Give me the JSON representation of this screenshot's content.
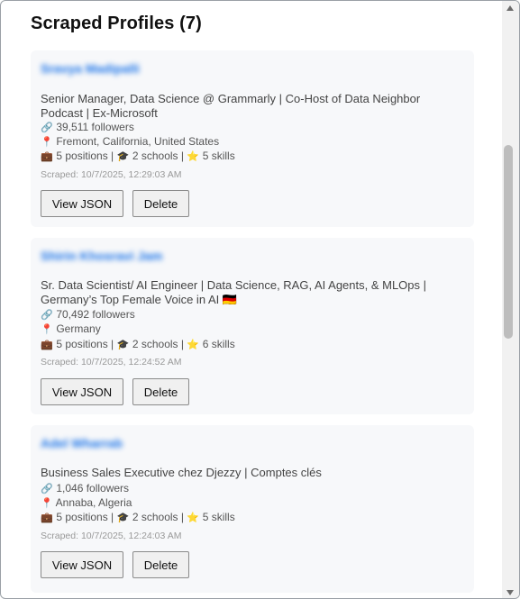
{
  "header": {
    "title": "Scraped Profiles (7)"
  },
  "icons": {
    "link": "link-icon",
    "location": "pin-icon",
    "positions": "briefcase-icon",
    "schools": "graduation-cap-icon",
    "skills": "star-icon"
  },
  "profiles": [
    {
      "name": "Sravya Madipalli",
      "headline": "Senior Manager, Data Science @ Grammarly | Co-Host of Data Neighbor Podcast | Ex-Microsoft",
      "followers": "39,511 followers",
      "location": "Fremont, California, United States",
      "stats": {
        "positions": "5 positions",
        "schools": "2 schools",
        "skills": "5 skills"
      },
      "scraped": "Scraped: 10/7/2025, 12:29:03 AM",
      "view_label": "View JSON",
      "delete_label": "Delete"
    },
    {
      "name": "Shirin Khosravi Jam",
      "headline": "Sr. Data Scientist/ AI Engineer | Data Science, RAG, AI Agents, & MLOps | Germany’s Top Female Voice in AI 🇩🇪",
      "followers": "70,492 followers",
      "location": "Germany",
      "stats": {
        "positions": "5 positions",
        "schools": "2 schools",
        "skills": "6 skills"
      },
      "scraped": "Scraped: 10/7/2025, 12:24:52 AM",
      "view_label": "View JSON",
      "delete_label": "Delete"
    },
    {
      "name": "Adel Wharrab",
      "headline": "Business Sales Executive chez Djezzy | Comptes clés",
      "followers": "1,046 followers",
      "location": "Annaba, Algeria",
      "stats": {
        "positions": "5 positions",
        "schools": "2 schools",
        "skills": "5 skills"
      },
      "scraped": "Scraped: 10/7/2025, 12:24:03 AM",
      "view_label": "View JSON",
      "delete_label": "Delete"
    }
  ],
  "colors": {
    "name": "#1a73e8",
    "card_bg": "#f7f8fa",
    "text": "#444444",
    "muted": "#999999"
  }
}
